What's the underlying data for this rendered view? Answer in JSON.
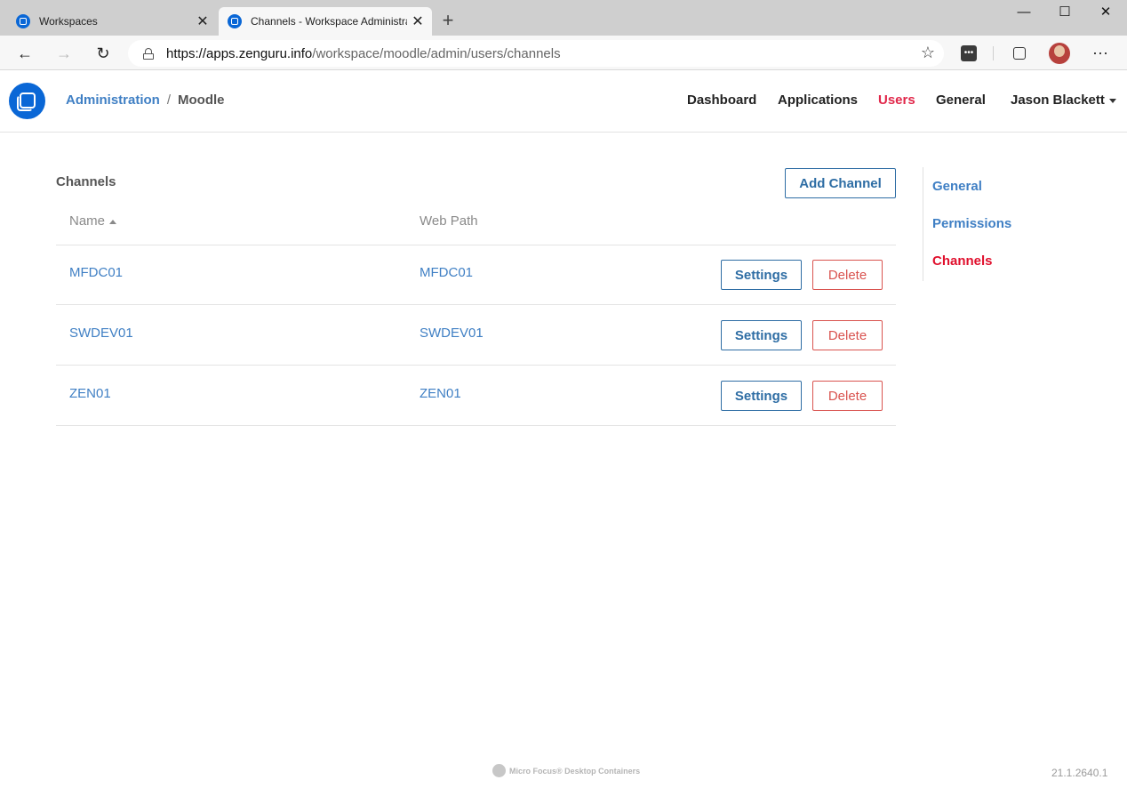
{
  "browser": {
    "tabs": [
      {
        "title": "Workspaces",
        "active": false
      },
      {
        "title": "Channels - Workspace Administration",
        "active": true
      }
    ],
    "url_host": "https://apps.zenguru.info",
    "url_path": "/workspace/moodle/admin/users/channels"
  },
  "header": {
    "breadcrumb": {
      "link": "Administration",
      "separator": "/",
      "current": "Moodle"
    },
    "nav": [
      "Dashboard",
      "Applications",
      "Users",
      "General"
    ],
    "active_nav": "Users",
    "user_name": "Jason Blackett"
  },
  "main": {
    "title": "Channels",
    "add_button": "Add Channel",
    "columns": {
      "name": "Name",
      "web_path": "Web Path"
    },
    "rows": [
      {
        "name": "MFDC01",
        "web_path": "MFDC01"
      },
      {
        "name": "SWDEV01",
        "web_path": "SWDEV01"
      },
      {
        "name": "ZEN01",
        "web_path": "ZEN01"
      }
    ],
    "settings_label": "Settings",
    "delete_label": "Delete"
  },
  "sidenav": {
    "items": [
      "General",
      "Permissions",
      "Channels"
    ],
    "active": "Channels"
  },
  "footer": {
    "brand": "Micro Focus® Desktop Containers",
    "version": "21.1.2640.1"
  },
  "colors": {
    "brand_blue": "#0a67d6",
    "link_blue": "#3f7fc4",
    "active_red": "#e1274a",
    "danger_red": "#d9534f"
  }
}
